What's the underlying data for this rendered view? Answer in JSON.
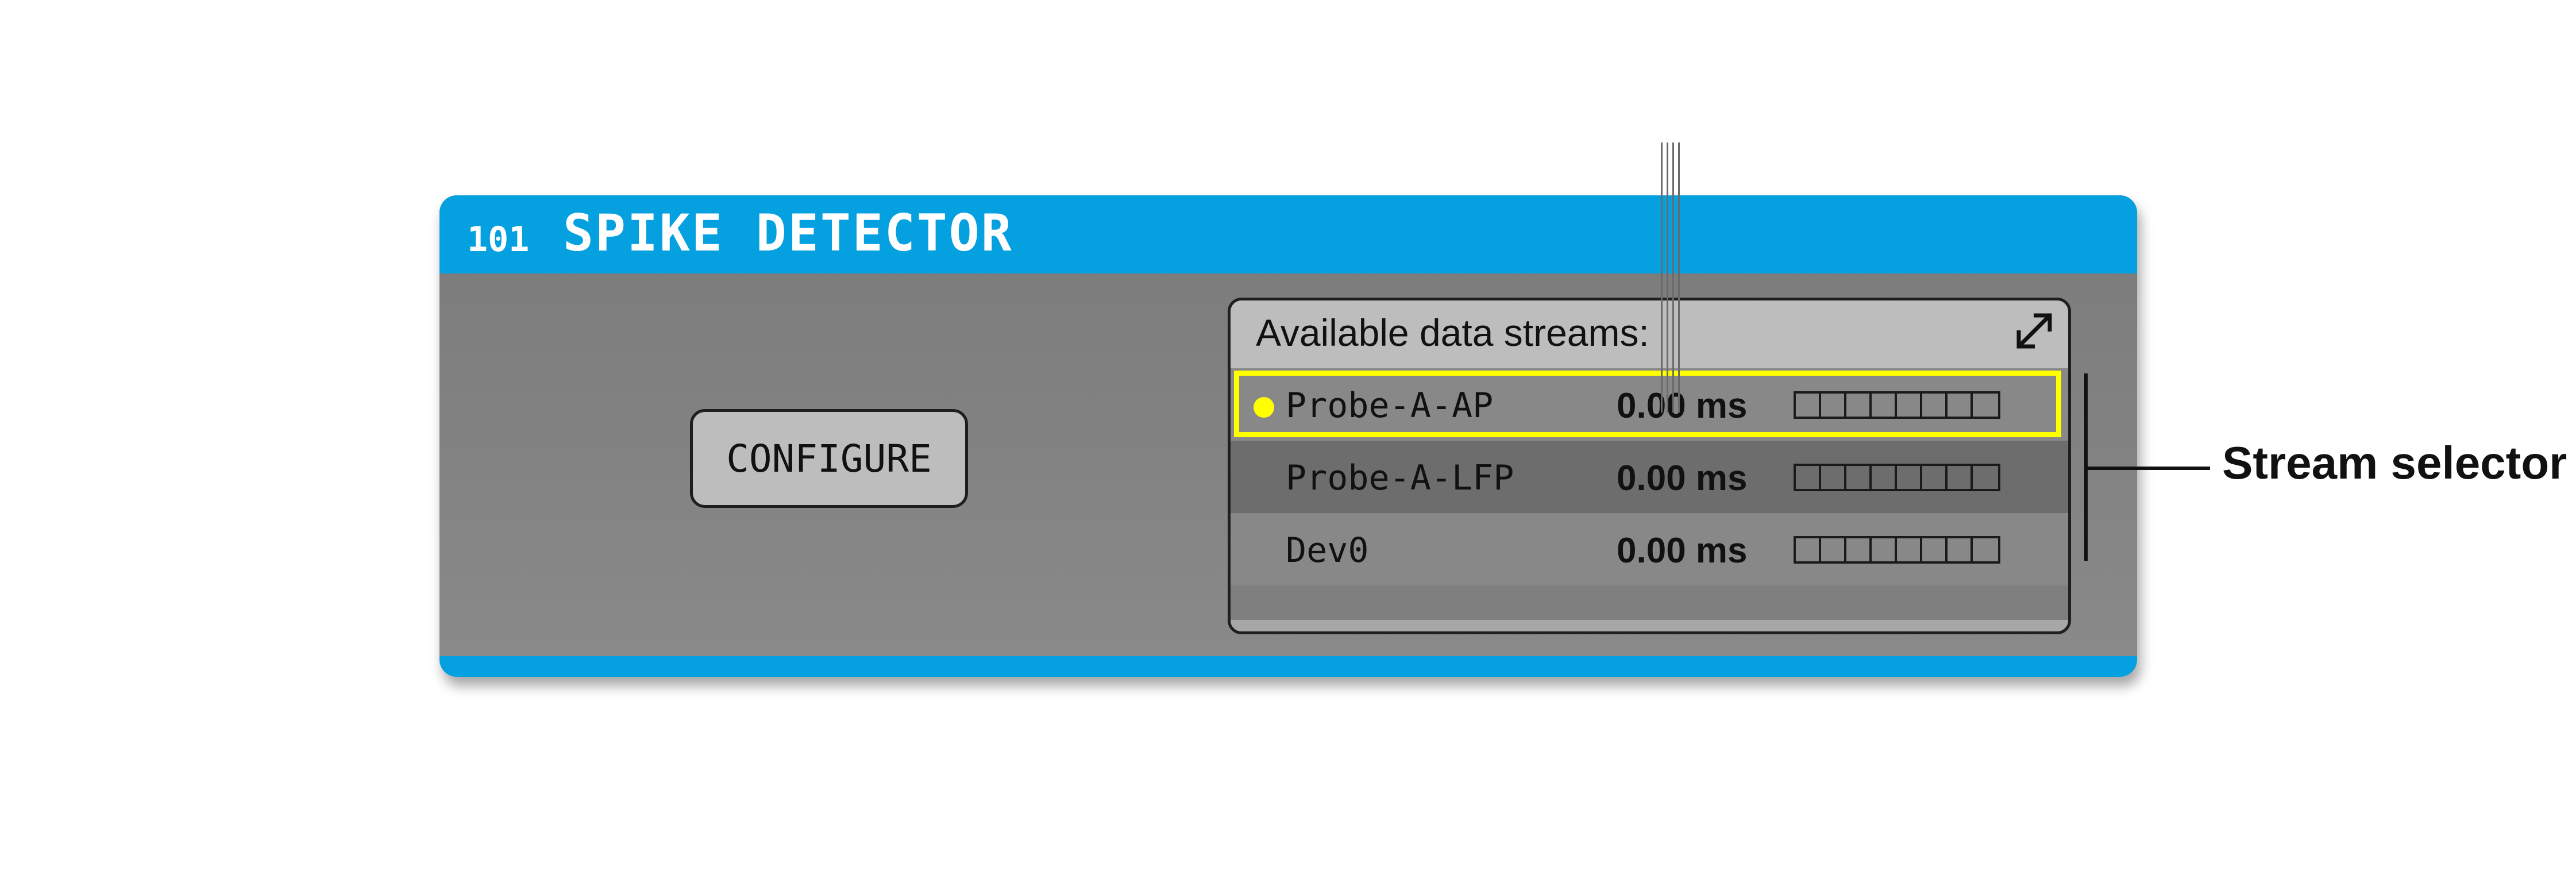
{
  "processor": {
    "node_id": "101",
    "name": "SPIKE DETECTOR",
    "configure_label": "CONFIGURE",
    "colors": {
      "title_bar": "#05a0e0",
      "body": "#808080",
      "highlight": "#ffff00"
    }
  },
  "stream_selector": {
    "title": "Available data streams:",
    "expand_icon": "expand-arrows-icon",
    "streams": [
      {
        "name": "Probe-A-AP",
        "latency": "0.00 ms",
        "selected": true
      },
      {
        "name": "Probe-A-LFP",
        "latency": "0.00 ms",
        "selected": false
      },
      {
        "name": "Dev0",
        "latency": "0.00 ms",
        "selected": false
      }
    ]
  },
  "annotation": {
    "label": "Stream selector"
  }
}
